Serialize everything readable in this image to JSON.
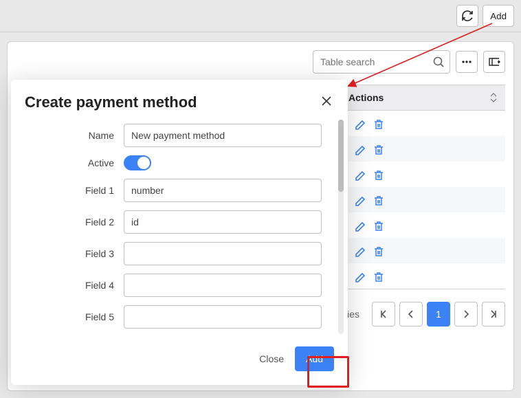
{
  "topbar": {
    "refresh_title": "Refresh",
    "add_label": "Add"
  },
  "card": {
    "search_placeholder": "Table search",
    "more_title": "More",
    "columns_title": "Columns",
    "actions_header": "Actions",
    "rows": 7,
    "footer_text": "tries",
    "pager": {
      "current": "1"
    }
  },
  "modal": {
    "title": "Create payment method",
    "fields": {
      "name_label": "Name",
      "name_value": "New payment method",
      "active_label": "Active",
      "active_value": true,
      "field1_label": "Field 1",
      "field1_value": "number",
      "field2_label": "Field 2",
      "field2_value": "id",
      "field3_label": "Field 3",
      "field3_value": "",
      "field4_label": "Field 4",
      "field4_value": "",
      "field5_label": "Field 5",
      "field5_value": ""
    },
    "footer": {
      "close_label": "Close",
      "add_label": "Add"
    }
  },
  "icons": {
    "refresh": "refresh-icon",
    "search": "search-icon",
    "dots": "more-horizontal-icon",
    "cols": "columns-icon",
    "pencil": "edit-icon",
    "trash": "delete-icon",
    "close": "close-icon",
    "sort": "sort-icon"
  }
}
